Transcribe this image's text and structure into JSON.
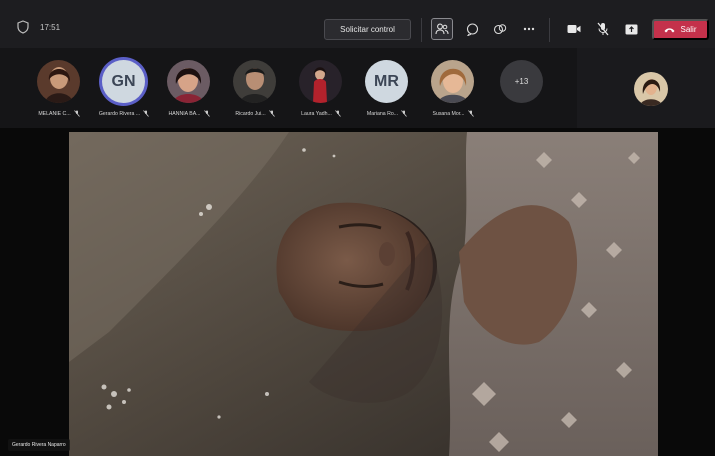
{
  "topbar": {
    "timer": "17:51",
    "request_control_label": "Solicitar control",
    "leave_label": "Salir",
    "leave_color": "#c4314b",
    "icons": [
      "shield-icon",
      "people-icon",
      "chat-icon",
      "reactions-icon",
      "more-options-icon",
      "camera-icon",
      "mic-off-icon",
      "share-screen-icon",
      "phone-hangup-icon"
    ]
  },
  "participants": [
    {
      "label": "MELANIE C...",
      "type": "photo"
    },
    {
      "label": "Gerardo Rivera ...",
      "type": "initials",
      "initials": "GN"
    },
    {
      "label": "HANNIA BA...",
      "type": "photo"
    },
    {
      "label": "Ricardo Jui...",
      "type": "photo"
    },
    {
      "label": "Laura Yadh...",
      "type": "photo"
    },
    {
      "label": "Mariana Ro...",
      "type": "initials",
      "initials": "MR"
    },
    {
      "label": "Susana Mor...",
      "type": "photo"
    }
  ],
  "overflow_count": "+13",
  "stage": {
    "speaker_name": "Gerardo Rivera Naparro"
  },
  "accent_color": "#5b5fc7"
}
